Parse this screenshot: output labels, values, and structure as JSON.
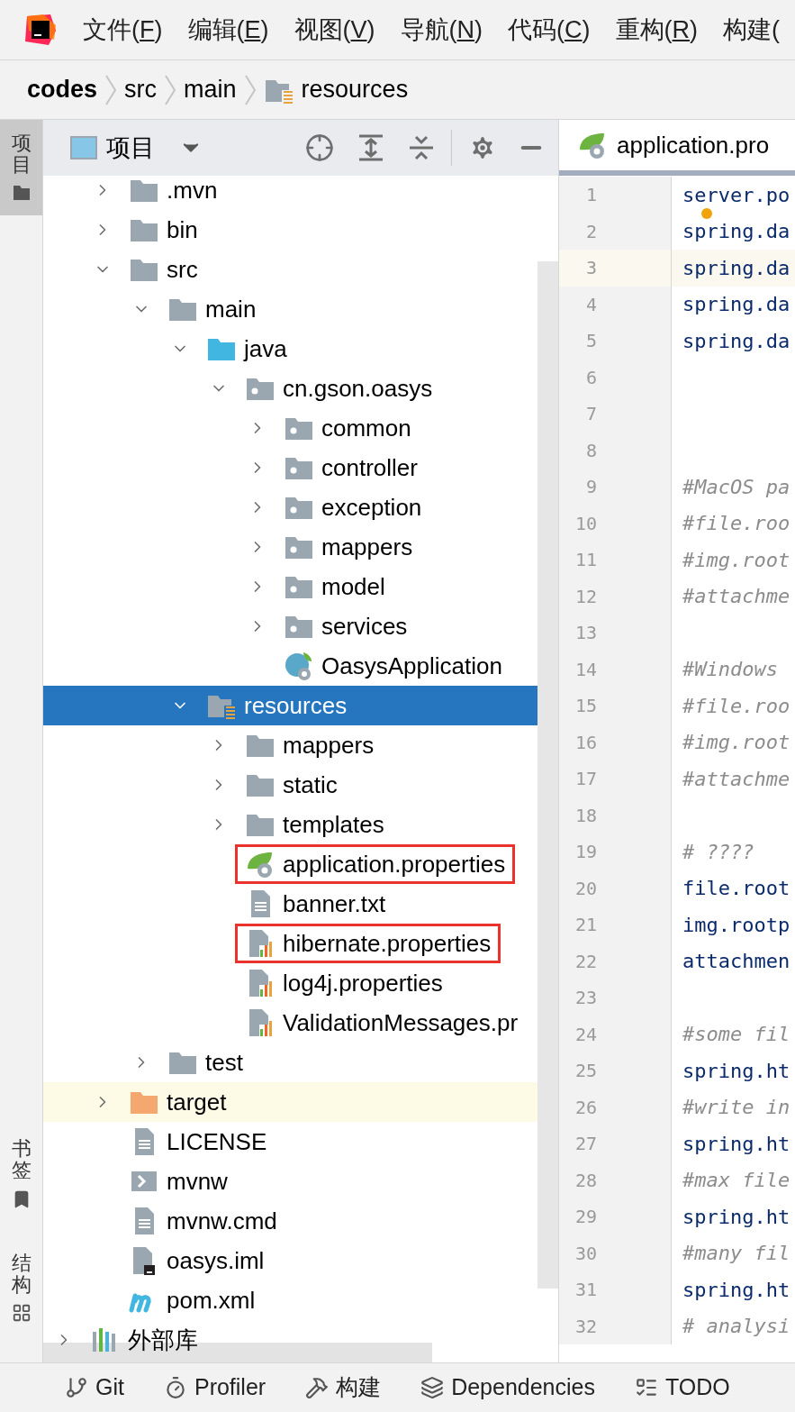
{
  "menu_bar": [
    {
      "before": "文件(",
      "key": "F",
      "after": ")"
    },
    {
      "before": "编辑(",
      "key": "E",
      "after": ")"
    },
    {
      "before": "视图(",
      "key": "V",
      "after": ")"
    },
    {
      "before": "导航(",
      "key": "N",
      "after": ")"
    },
    {
      "before": "代码(",
      "key": "C",
      "after": ")"
    },
    {
      "before": "重构(",
      "key": "R",
      "after": ")"
    },
    {
      "before": "构建("
    }
  ],
  "breadcrumb": [
    {
      "label": "codes",
      "bold": true,
      "kind": "plain"
    },
    {
      "label": "src",
      "bold": false,
      "kind": "plain"
    },
    {
      "label": "main",
      "bold": false,
      "kind": "plain"
    },
    {
      "label": "resources",
      "bold": false,
      "kind": "resources"
    }
  ],
  "side_tabs_top": [
    {
      "label": "项目",
      "selected": true,
      "kind": "folder"
    }
  ],
  "side_tabs_bottom": [
    {
      "label": "书签",
      "selected": false,
      "kind": "bookmark"
    },
    {
      "label": "结构",
      "selected": false,
      "kind": "structure"
    }
  ],
  "project_panel": {
    "title": "项目",
    "tree": [
      {
        "label": ".mvn",
        "kind": "folder",
        "expanded": false,
        "selected": false,
        "hovered": false,
        "marked": false
      },
      {
        "label": "bin",
        "kind": "folder",
        "expanded": false,
        "selected": false,
        "hovered": false,
        "marked": false
      },
      {
        "label": "src",
        "kind": "folder",
        "expanded": true,
        "selected": false,
        "hovered": false,
        "marked": false,
        "children": [
          {
            "label": "main",
            "kind": "folder",
            "expanded": true,
            "selected": false,
            "hovered": false,
            "marked": false,
            "children": [
              {
                "label": "java",
                "kind": "source",
                "expanded": true,
                "selected": false,
                "hovered": false,
                "marked": false,
                "children": [
                  {
                    "label": "cn.gson.oasys",
                    "kind": "package",
                    "expanded": true,
                    "selected": false,
                    "hovered": false,
                    "marked": false,
                    "children": [
                      {
                        "label": "common",
                        "kind": "package",
                        "expanded": false,
                        "selected": false,
                        "hovered": false,
                        "marked": false
                      },
                      {
                        "label": "controller",
                        "kind": "package",
                        "expanded": false,
                        "selected": false,
                        "hovered": false,
                        "marked": false
                      },
                      {
                        "label": "exception",
                        "kind": "package",
                        "expanded": false,
                        "selected": false,
                        "hovered": false,
                        "marked": false
                      },
                      {
                        "label": "mappers",
                        "kind": "package",
                        "expanded": false,
                        "selected": false,
                        "hovered": false,
                        "marked": false
                      },
                      {
                        "label": "model",
                        "kind": "package",
                        "expanded": false,
                        "selected": false,
                        "hovered": false,
                        "marked": false
                      },
                      {
                        "label": "services",
                        "kind": "package",
                        "expanded": false,
                        "selected": false,
                        "hovered": false,
                        "marked": false
                      },
                      {
                        "label": "OasysApplication",
                        "kind": "spring-class",
                        "selected": false,
                        "hovered": false,
                        "marked": false
                      }
                    ]
                  }
                ]
              },
              {
                "label": "resources",
                "kind": "resources",
                "expanded": true,
                "selected": true,
                "hovered": false,
                "marked": false,
                "children": [
                  {
                    "label": "mappers",
                    "kind": "folder",
                    "expanded": false,
                    "selected": false,
                    "hovered": false,
                    "marked": false
                  },
                  {
                    "label": "static",
                    "kind": "folder",
                    "expanded": false,
                    "selected": false,
                    "hovered": false,
                    "marked": false
                  },
                  {
                    "label": "templates",
                    "kind": "folder",
                    "expanded": false,
                    "selected": false,
                    "hovered": false,
                    "marked": false
                  },
                  {
                    "label": "application.properties",
                    "kind": "spring-properties",
                    "selected": false,
                    "hovered": false,
                    "marked": true
                  },
                  {
                    "label": "banner.txt",
                    "kind": "text",
                    "selected": false,
                    "hovered": false,
                    "marked": false
                  },
                  {
                    "label": "hibernate.properties",
                    "kind": "properties",
                    "selected": false,
                    "hovered": false,
                    "marked": true
                  },
                  {
                    "label": "log4j.properties",
                    "kind": "properties",
                    "selected": false,
                    "hovered": false,
                    "marked": false
                  },
                  {
                    "label": "ValidationMessages.pr",
                    "kind": "properties",
                    "selected": false,
                    "hovered": false,
                    "marked": false
                  }
                ]
              }
            ]
          },
          {
            "label": "test",
            "kind": "folder",
            "expanded": false,
            "selected": false,
            "hovered": false,
            "marked": false
          }
        ]
      },
      {
        "label": "target",
        "kind": "excluded",
        "expanded": false,
        "selected": false,
        "hovered": true,
        "marked": false
      },
      {
        "label": "LICENSE",
        "kind": "text",
        "selected": false,
        "hovered": false,
        "marked": false
      },
      {
        "label": "mvnw",
        "kind": "script",
        "selected": false,
        "hovered": false,
        "marked": false
      },
      {
        "label": "mvnw.cmd",
        "kind": "text",
        "selected": false,
        "hovered": false,
        "marked": false
      },
      {
        "label": "oasys.iml",
        "kind": "iml",
        "selected": false,
        "hovered": false,
        "marked": false
      },
      {
        "label": "pom.xml",
        "kind": "maven",
        "selected": false,
        "hovered": false,
        "marked": false
      }
    ],
    "root_items": [
      {
        "label": "外部库",
        "kind": "library",
        "expanded": false,
        "selected": false,
        "hovered": false,
        "marked": false
      }
    ]
  },
  "editor": {
    "tab": {
      "label": "application.pro",
      "selected": true
    },
    "lines": [
      {
        "number": "1",
        "text": "server.po",
        "kind": "code",
        "current": false
      },
      {
        "number": "2",
        "text": "spring.da",
        "kind": "code",
        "current": false,
        "bulb": true
      },
      {
        "number": "3",
        "text": "spring.da",
        "kind": "code",
        "current": true
      },
      {
        "number": "4",
        "text": "spring.da",
        "kind": "code",
        "current": false
      },
      {
        "number": "5",
        "text": "spring.da",
        "kind": "code",
        "current": false
      },
      {
        "number": "6",
        "current": false
      },
      {
        "number": "7",
        "current": false
      },
      {
        "number": "8",
        "current": false
      },
      {
        "number": "9",
        "text": "#MacOS pa",
        "kind": "comment",
        "current": false
      },
      {
        "number": "10",
        "text": "#file.roo",
        "kind": "comment",
        "current": false
      },
      {
        "number": "11",
        "text": "#img.root",
        "kind": "comment",
        "current": false
      },
      {
        "number": "12",
        "text": "#attachme",
        "kind": "comment",
        "current": false
      },
      {
        "number": "13",
        "current": false
      },
      {
        "number": "14",
        "text": "#Windows",
        "kind": "comment",
        "current": false
      },
      {
        "number": "15",
        "text": "#file.roo",
        "kind": "comment",
        "current": false
      },
      {
        "number": "16",
        "text": "#img.root",
        "kind": "comment",
        "current": false
      },
      {
        "number": "17",
        "text": "#attachme",
        "kind": "comment",
        "current": false
      },
      {
        "number": "18",
        "current": false
      },
      {
        "number": "19",
        "text": "# ????",
        "kind": "comment",
        "current": false
      },
      {
        "number": "20",
        "text": "file.root",
        "kind": "code",
        "current": false
      },
      {
        "number": "21",
        "text": "img.rootp",
        "kind": "code",
        "current": false
      },
      {
        "number": "22",
        "text": "attachmen",
        "kind": "code",
        "current": false
      },
      {
        "number": "23",
        "current": false
      },
      {
        "number": "24",
        "text": "#some fil",
        "kind": "comment",
        "current": false
      },
      {
        "number": "25",
        "text": "spring.ht",
        "kind": "code",
        "current": false
      },
      {
        "number": "26",
        "text": "#write in",
        "kind": "comment",
        "current": false
      },
      {
        "number": "27",
        "text": "spring.ht",
        "kind": "code",
        "current": false
      },
      {
        "number": "28",
        "text": "#max file",
        "kind": "comment",
        "current": false
      },
      {
        "number": "29",
        "text": "spring.ht",
        "kind": "code",
        "current": false
      },
      {
        "number": "30",
        "text": "#many fil",
        "kind": "comment",
        "current": false
      },
      {
        "number": "31",
        "text": "spring.ht",
        "kind": "code",
        "current": false
      },
      {
        "number": "32",
        "text": "# analysi",
        "kind": "comment",
        "current": false
      }
    ]
  },
  "bottom_bar": [
    {
      "label": "Git",
      "kind": "git"
    },
    {
      "label": "Profiler",
      "kind": "profiler"
    },
    {
      "label": "构建",
      "kind": "build"
    },
    {
      "label": "Dependencies",
      "kind": "dependencies"
    },
    {
      "label": "TODO",
      "kind": "todo"
    }
  ]
}
